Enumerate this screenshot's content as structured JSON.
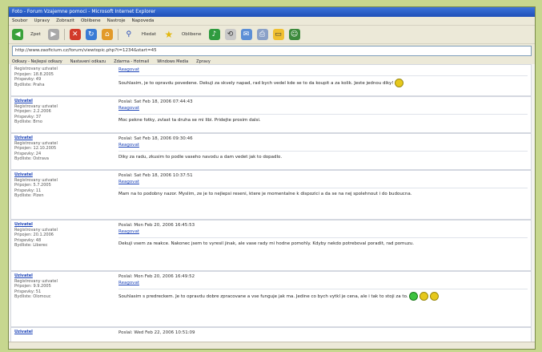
{
  "window": {
    "title": "Foto - Forum Vzajemne pomoci - Microsoft Internet Explorer",
    "menu": [
      "Soubor",
      "Upravy",
      "Zobrazit",
      "Oblibene",
      "Nastroje",
      "Napoveda"
    ],
    "address": "http://www.zaoficium.cz/forum/viewtopic.php?t=1234&start=45"
  },
  "toolbar": {
    "back": "Zpet",
    "search": "Hledat",
    "favorites": "Oblibene"
  },
  "links": [
    "Odkazy - Nejlepsi odkazy",
    "Nastaveni odkazu",
    "Zdarma - Hotmail",
    "Windows Media",
    "Zpravy"
  ],
  "posts": [
    {
      "author": "",
      "rank": "Registrovany uzivatel",
      "joined": "Pripojen: 18.8.2005",
      "count": "Prispevky: 49",
      "location": "Bydliste: Praha",
      "header": "",
      "reply": "Reagovat",
      "text": "Souhlasim, je to opravdu povedene. Dekuji za skvely napad, rad bych vedel kde se to da koupit a za kolik. Jeste jednou diky!"
    },
    {
      "author": "Uzivatel",
      "rank": "Registrovany uzivatel",
      "joined": "Pripojen: 2.2.2006",
      "count": "Prispevky: 37",
      "location": "Bydliste: Brno",
      "header": "Poslal: Sat Feb 18, 2006 07:44:43",
      "reply": "Reagovat",
      "text": "Moc pekne fotky, zvlast ta druha se mi libi. Pridejte prosim dalsi."
    },
    {
      "author": "Uzivatel",
      "rank": "Registrovany uzivatel",
      "joined": "Pripojen: 12.10.2005",
      "count": "Prispevky: 24",
      "location": "Bydliste: Ostrava",
      "header": "Poslal: Sat Feb 18, 2006 09:30:46",
      "reply": "Reagovat",
      "text": "Diky za radu, zkusim to podle vaseho navodu a dam vedet jak to dopadlo."
    },
    {
      "author": "Uzivatel",
      "rank": "Registrovany uzivatel",
      "joined": "Pripojen: 5.7.2005",
      "count": "Prispevky: 11",
      "location": "Bydliste: Plzen",
      "header": "Poslal: Sat Feb 18, 2006 10:37:51",
      "reply": "Reagovat",
      "text": "Mam na to podobny nazor. Myslim, ze je to nejlepsi reseni, ktere je momentalne k dispozici a da se na nej spolehnout i do budoucna."
    },
    {
      "author": "Uzivatel",
      "rank": "Registrovany uzivatel",
      "joined": "Pripojen: 20.1.2006",
      "count": "Prispevky: 48",
      "location": "Bydliste: Liberec",
      "header": "Poslal: Mon Feb 20, 2006 16:45:53",
      "reply": "Reagovat",
      "text": "Dekuji vsem za reakce. Nakonec jsem to vyresil jinak, ale vase rady mi hodne pomohly. Kdyby nekdo potreboval poradit, rad pomuzu."
    },
    {
      "author": "Uzivatel",
      "rank": "Registrovany uzivatel",
      "joined": "Pripojen: 9.9.2005",
      "count": "Prispevky: 51",
      "location": "Bydliste: Olomouc",
      "header": "Poslal: Mon Feb 20, 2006 16:49:52",
      "reply": "Reagovat",
      "text": "Souhlasim s predreckem. Je to opravdu dobre zpracovane a vse funguje jak ma. Jedine co bych vytkl je cena, ale i tak to stoji za to."
    },
    {
      "author": "Uzivatel",
      "rank": "",
      "joined": "",
      "count": "",
      "location": "",
      "header": "Poslal: Wed Feb 22, 2006 10:51:09",
      "reply": "",
      "text": ""
    }
  ],
  "colors": {
    "background": "#c7d78f",
    "link": "#1d44b8",
    "titlebar": "#2a5fc8"
  }
}
